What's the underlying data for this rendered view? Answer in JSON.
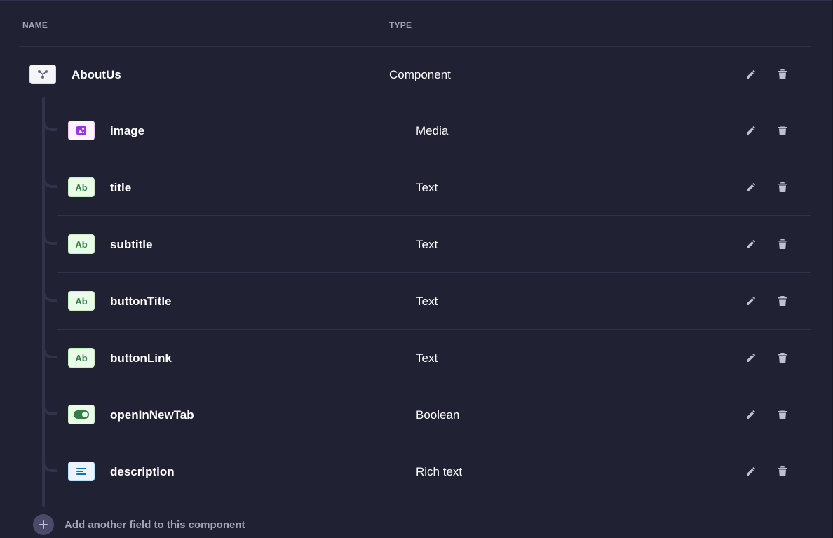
{
  "columns": {
    "name": "NAME",
    "type": "TYPE"
  },
  "parent": {
    "name": "AboutUs",
    "type": "Component",
    "icon": "component-icon",
    "actions": {
      "edit": "pencil-icon",
      "delete": "trash-icon"
    }
  },
  "fields": [
    {
      "name": "image",
      "type": "Media",
      "icon": "media-icon"
    },
    {
      "name": "title",
      "type": "Text",
      "icon": "text-icon",
      "icon_label": "Ab"
    },
    {
      "name": "subtitle",
      "type": "Text",
      "icon": "text-icon",
      "icon_label": "Ab"
    },
    {
      "name": "buttonTitle",
      "type": "Text",
      "icon": "text-icon",
      "icon_label": "Ab"
    },
    {
      "name": "buttonLink",
      "type": "Text",
      "icon": "text-icon",
      "icon_label": "Ab"
    },
    {
      "name": "openInNewTab",
      "type": "Boolean",
      "icon": "boolean-icon"
    },
    {
      "name": "description",
      "type": "Rich text",
      "icon": "rich-text-icon"
    }
  ],
  "add_field": {
    "label": "Add another field to this component",
    "icon": "plus-icon"
  },
  "colors": {
    "background": "#212134",
    "border": "#32324d",
    "muted_text": "#a5a5ba",
    "text_green": "#328048",
    "media_purple": "#9736e8",
    "rich_text_blue": "#0c75af"
  }
}
